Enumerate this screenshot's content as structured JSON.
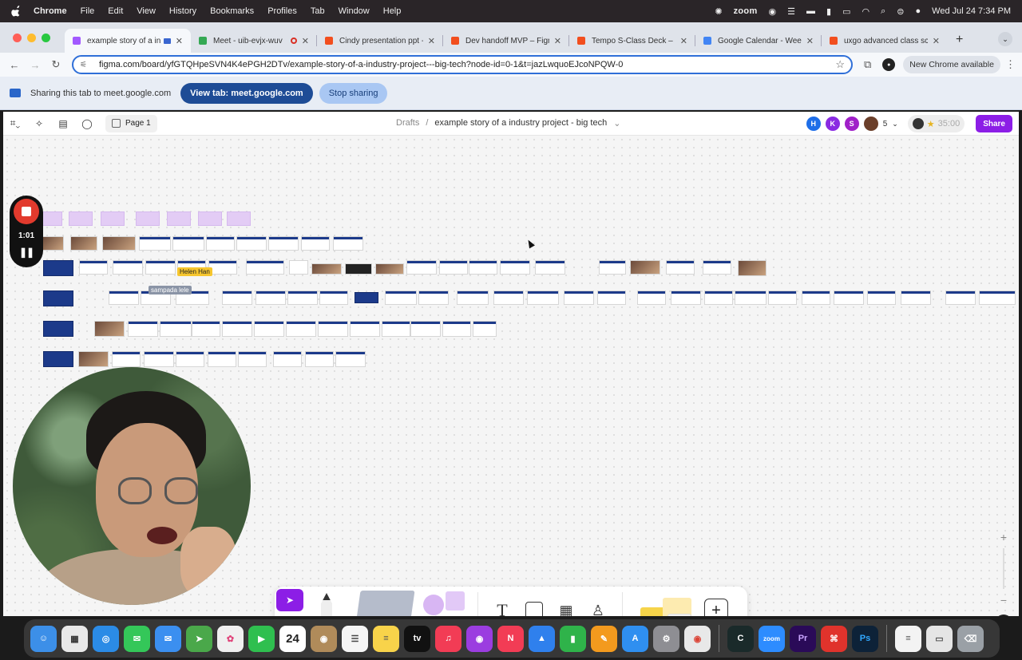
{
  "menubar": {
    "app": "Chrome",
    "items": [
      "File",
      "Edit",
      "View",
      "History",
      "Bookmarks",
      "Profiles",
      "Tab",
      "Window",
      "Help"
    ],
    "zoom": "zoom",
    "clock": "Wed Jul 24  7:34 PM"
  },
  "tabs": [
    {
      "title": "example story of a ind",
      "color": "#a259ff",
      "active": true
    },
    {
      "title": "Meet - uib-evjx-wuv",
      "color": "#34a853"
    },
    {
      "title": "Cindy presentation ppt -",
      "color": "#f24e1e"
    },
    {
      "title": "Dev handoff MVP – Figma",
      "color": "#f24e1e"
    },
    {
      "title": "Tempo S-Class Deck – Fi",
      "color": "#f24e1e"
    },
    {
      "title": "Google Calendar - Week",
      "color": "#4285f4"
    },
    {
      "title": "uxgo advanced class scri",
      "color": "#f24e1e"
    }
  ],
  "address": {
    "url": "figma.com/board/yfGTQHpeSVN4K4ePGH2DTv/example-story-of-a-industry-project---big-tech?node-id=0-1&t=jazLwquoEJcoNPQW-0",
    "new_chrome": "New Chrome available"
  },
  "sharebar": {
    "text": "Sharing this tab to meet.google.com",
    "view_tab": "View tab: meet.google.com",
    "stop": "Stop sharing"
  },
  "figma": {
    "page": "Page 1",
    "breadcrumb_root": "Drafts",
    "file_name": "example story of a industry project - big tech",
    "avatars": [
      {
        "letter": "H",
        "color": "#1e6ee8"
      },
      {
        "letter": "K",
        "color": "#8a2be2"
      },
      {
        "letter": "S",
        "color": "#a020c8"
      }
    ],
    "avatar_count": "5",
    "timer": "35:00",
    "share": "Share",
    "cursors": [
      {
        "name": "Helen Han",
        "color": "#f6c62e"
      },
      {
        "name": "sampada lele",
        "color": "#8a94a6"
      }
    ]
  },
  "recording": {
    "time": "1:01"
  },
  "dock": {
    "apps": [
      {
        "name": "Finder",
        "color": "#3c8fe8",
        "glyph": "☺"
      },
      {
        "name": "Launchpad",
        "color": "#e8e8e8",
        "glyph": "▦"
      },
      {
        "name": "Safari",
        "color": "#2b8be6",
        "glyph": "◎"
      },
      {
        "name": "Messages",
        "color": "#34c759",
        "glyph": "✉"
      },
      {
        "name": "Mail",
        "color": "#3b8ff0",
        "glyph": "✉"
      },
      {
        "name": "Maps",
        "color": "#4aa84a",
        "glyph": "➤"
      },
      {
        "name": "Photos",
        "color": "#f0f0f0",
        "glyph": "✿"
      },
      {
        "name": "FaceTime",
        "color": "#2fbf4f",
        "glyph": "▶"
      },
      {
        "name": "Calendar",
        "color": "#ffffff",
        "glyph": "24"
      },
      {
        "name": "Contacts",
        "color": "#b08b5a",
        "glyph": "◉"
      },
      {
        "name": "Reminders",
        "color": "#f5f5f5",
        "glyph": "☰"
      },
      {
        "name": "Notes",
        "color": "#f8d34a",
        "glyph": "≡"
      },
      {
        "name": "TV",
        "color": "#111111",
        "glyph": "tv"
      },
      {
        "name": "Music",
        "color": "#f23c55",
        "glyph": "♫"
      },
      {
        "name": "Podcasts",
        "color": "#9b3de0",
        "glyph": "◉"
      },
      {
        "name": "News",
        "color": "#f23c55",
        "glyph": "N"
      },
      {
        "name": "Keynote",
        "color": "#2f80ed",
        "glyph": "▲"
      },
      {
        "name": "Numbers",
        "color": "#2fb34a",
        "glyph": "▮"
      },
      {
        "name": "Pages",
        "color": "#f39a1e",
        "glyph": "✎"
      },
      {
        "name": "App Store",
        "color": "#2f8ff0",
        "glyph": "A"
      },
      {
        "name": "System Settings",
        "color": "#8e8e93",
        "glyph": "⚙"
      },
      {
        "name": "Chrome",
        "color": "#e8e8e8",
        "glyph": "◉"
      },
      {
        "name": "Cursor",
        "color": "#1a2a2a",
        "glyph": "C"
      },
      {
        "name": "Zoom",
        "color": "#2d8cff",
        "glyph": "zoom"
      },
      {
        "name": "Premiere",
        "color": "#2a0a58",
        "glyph": "Pr"
      },
      {
        "name": "Acrobat",
        "color": "#e0332c",
        "glyph": "⌘"
      },
      {
        "name": "Photoshop",
        "color": "#0d2238",
        "glyph": "Ps"
      },
      {
        "name": "Document",
        "color": "#f3f3f3",
        "glyph": "≡"
      },
      {
        "name": "Window",
        "color": "#e5e5e5",
        "glyph": "▭"
      },
      {
        "name": "Trash",
        "color": "#9aa0a6",
        "glyph": "⌫"
      }
    ]
  }
}
